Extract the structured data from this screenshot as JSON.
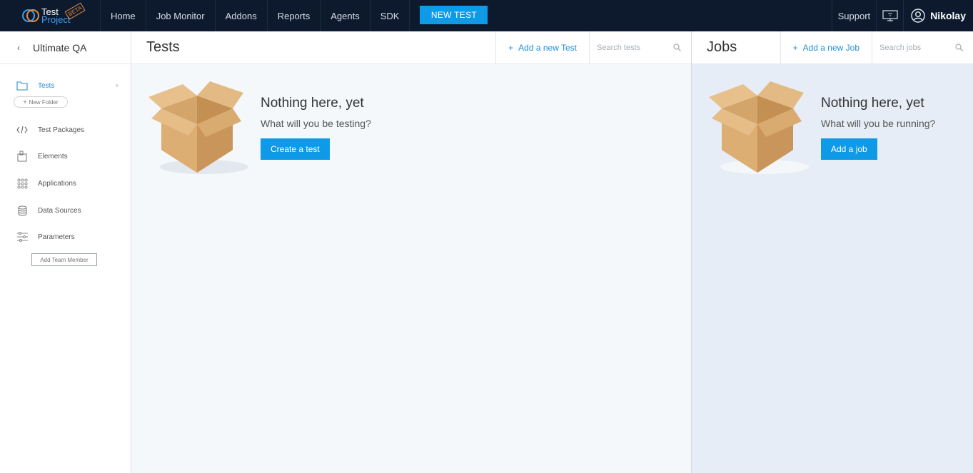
{
  "nav": {
    "logo_line1": "Test",
    "logo_line2": "Project",
    "logo_badge": "BETA",
    "items": [
      "Home",
      "Job Monitor",
      "Addons",
      "Reports",
      "Agents",
      "SDK"
    ],
    "new_test": "NEW TEST",
    "support": "Support",
    "monitor_icon": "monitor-icon",
    "user_name": "Nikolay",
    "colors": {
      "bar": "#0d1a2e",
      "accent": "#0f9ae8"
    }
  },
  "sidebar": {
    "back_icon": "chevron-left-icon",
    "project_name": "Ultimate QA",
    "items": [
      {
        "label": "Tests",
        "icon": "folder-icon",
        "active": true
      },
      {
        "label": "Test Packages",
        "icon": "code-icon"
      },
      {
        "label": "Elements",
        "icon": "elements-icon"
      },
      {
        "label": "Applications",
        "icon": "apps-grid-icon"
      },
      {
        "label": "Data Sources",
        "icon": "database-icon"
      },
      {
        "label": "Parameters",
        "icon": "sliders-icon"
      }
    ],
    "new_folder": "New Folder",
    "add_team_member": "Add Team Member"
  },
  "tests": {
    "title": "Tests",
    "add_label": "Add a new Test",
    "search_placeholder": "Search tests",
    "empty_title": "Nothing here, yet",
    "empty_subtitle": "What will you be testing?",
    "empty_button": "Create a test"
  },
  "jobs": {
    "title": "Jobs",
    "add_label": "Add a new Job",
    "search_placeholder": "Search jobs",
    "empty_title": "Nothing here, yet",
    "empty_subtitle": "What will you be running?",
    "empty_button": "Add a job"
  }
}
